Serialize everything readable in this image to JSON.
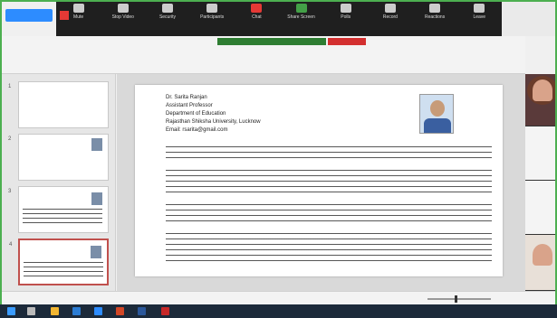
{
  "zoom": {
    "tag": "",
    "toolbar": [
      "Mute",
      "Stop Video",
      "Security",
      "Participants",
      "Chat",
      "Share Screen",
      "Polls",
      "Record",
      "Reactions",
      "Leave"
    ],
    "share_notice": "",
    "stop_share": ""
  },
  "ribbon": {
    "row1": "",
    "row2": "",
    "row3": ""
  },
  "right_top": "",
  "thumbnails": [
    "1",
    "2",
    "3",
    "4"
  ],
  "slide": {
    "lines": [
      "Dr. Sarita Ranjan",
      "Assistant Professor",
      "Department of Education",
      "Rajasthan Shiksha University, Lucknow",
      "Email: rsarita@gmail.com"
    ]
  },
  "videos": [
    "",
    "",
    "",
    ""
  ],
  "status": {
    "left": "",
    "middle": "",
    "right": ""
  },
  "colors": {
    "zoom_blue": "#2d8cff",
    "share_green": "#4caf50",
    "alert_red": "#d32f2f"
  },
  "icons": [
    "zoom-logo-icon",
    "mic-icon",
    "video-icon",
    "shield-icon",
    "participants-icon",
    "chat-icon",
    "share-icon",
    "record-icon",
    "reactions-icon",
    "leave-icon",
    "windows-start-icon"
  ]
}
